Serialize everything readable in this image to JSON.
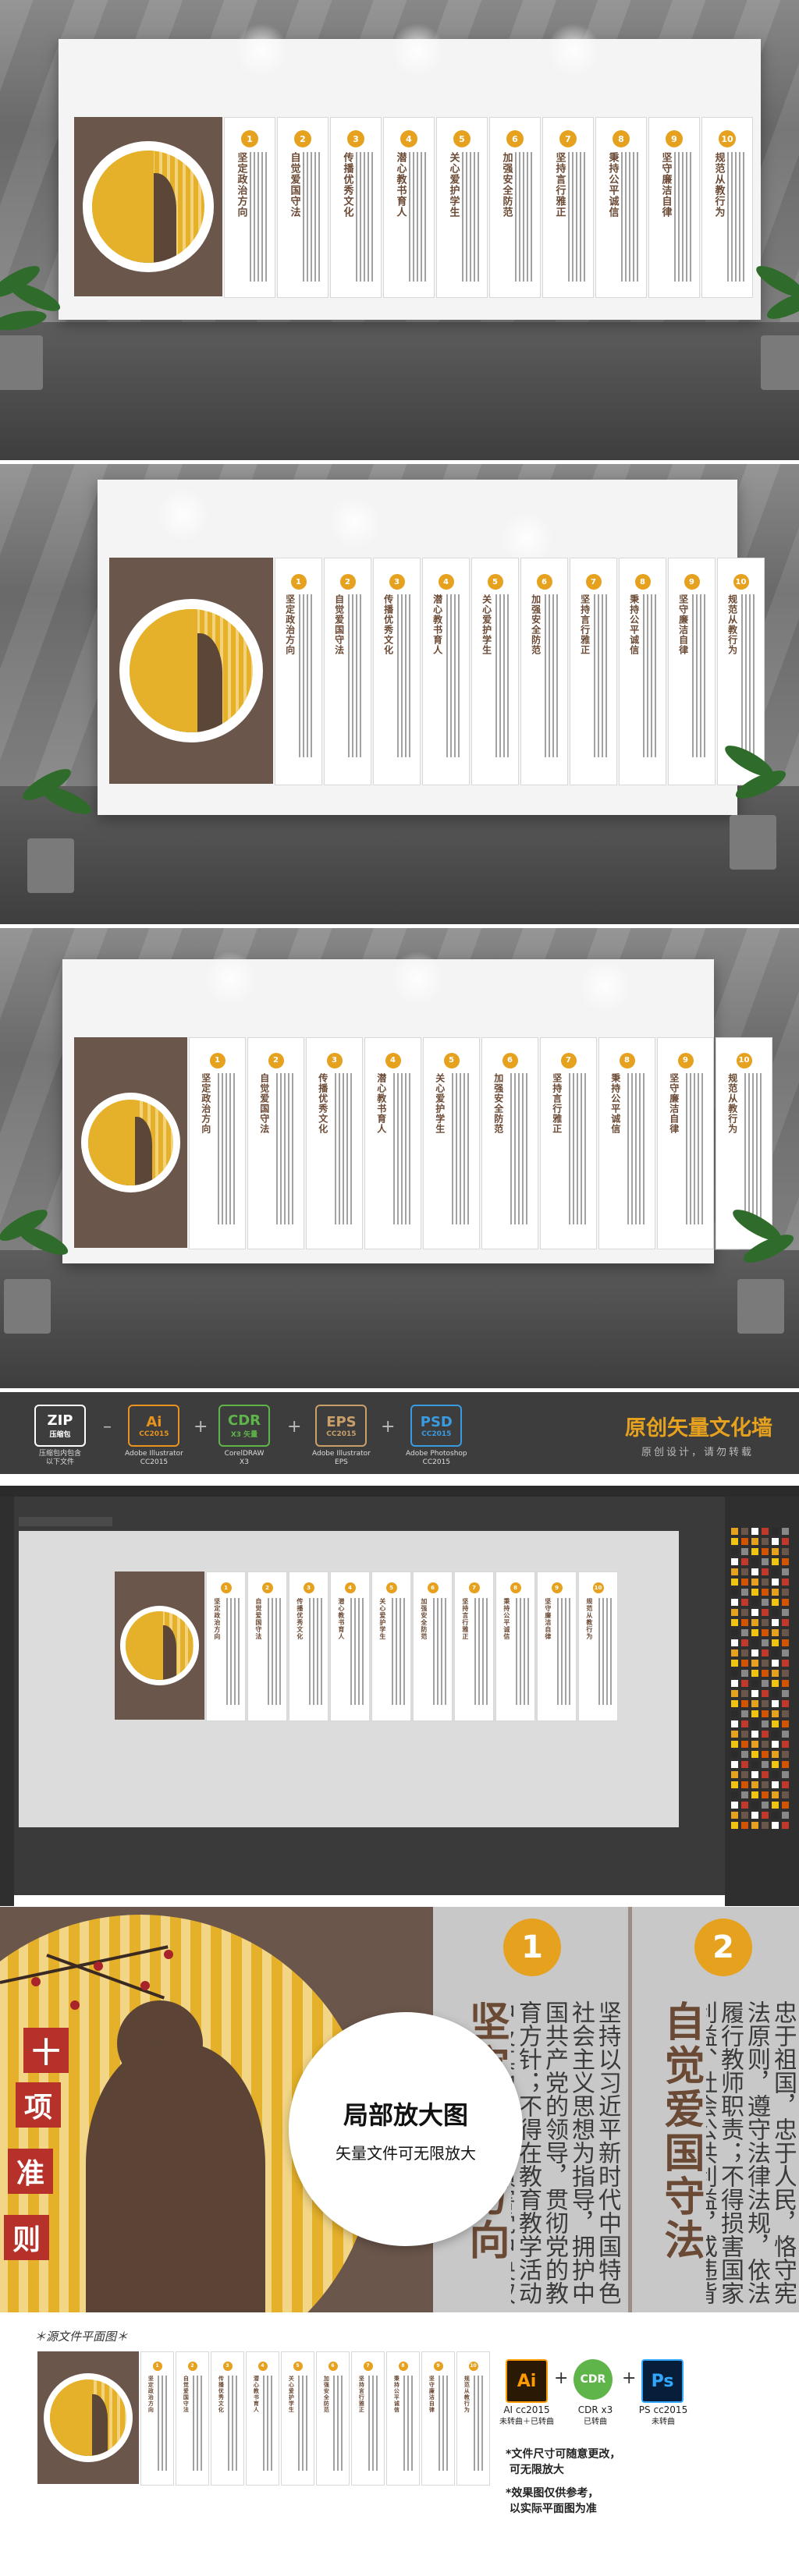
{
  "cards": [
    {
      "n": "1",
      "title": "坚定政治方向"
    },
    {
      "n": "2",
      "title": "自觉爱国守法"
    },
    {
      "n": "3",
      "title": "传播优秀文化"
    },
    {
      "n": "4",
      "title": "潜心教书育人"
    },
    {
      "n": "5",
      "title": "关心爱护学生"
    },
    {
      "n": "6",
      "title": "加强安全防范"
    },
    {
      "n": "7",
      "title": "坚持言行雅正"
    },
    {
      "n": "8",
      "title": "秉持公平诚信"
    },
    {
      "n": "9",
      "title": "坚守廉洁自律"
    },
    {
      "n": "10",
      "title": "规范从教行为"
    }
  ],
  "seal_text": [
    "十",
    "项",
    "准",
    "则"
  ],
  "formats": [
    {
      "key": "zip",
      "badge": "ZIP",
      "badge_sub": "压缩包",
      "caption": "压缩包内包含\n以下文件",
      "color": "#ffffff"
    },
    {
      "key": "ai",
      "badge": "Ai",
      "badge_sub": "CC2015",
      "caption": "Adobe Illustrator\nCC2015",
      "color": "#e8931e"
    },
    {
      "key": "cdr",
      "badge": "CDR",
      "badge_sub": "X3 矢量",
      "caption": "CorelDRAW\nX3",
      "color": "#5fb54a"
    },
    {
      "key": "eps",
      "badge": "EPS",
      "badge_sub": "CC2015",
      "caption": "Adobe Illustrator\nEPS",
      "color": "#c9a06a"
    },
    {
      "key": "psd",
      "badge": "PSD",
      "badge_sub": "CC2015",
      "caption": "Adobe Photoshop\nCC2015",
      "color": "#3a9be0"
    }
  ],
  "format_bar": {
    "title": "原创矢量文化墙",
    "subtitle": "原创设计，请勿转载"
  },
  "zoom": {
    "badge_title": "局部放大图",
    "badge_sub": "矢量文件可无限放大",
    "card1_num": "1",
    "card1_title": "坚定政治方向",
    "card1_body": "坚持以习近平新时代中国特色社会主义思想为指导，拥护中国共产党的领导，贯彻党的教育方针；不得在教育教学活动中及其他场合有损害党中央权威、违背党的路线方针政策的言行。",
    "card2_num": "2",
    "card2_title": "自觉爱国守法",
    "card2_body": "忠于祖国，忠于人民，恪守宪法原则，遵守法律法规，依法履行教师职责；不得损害国家利益、社会公共利益，或违背社会公序良俗。"
  },
  "plan": {
    "title": "＊源文件平面图＊",
    "ai": {
      "badge": "Ai",
      "label": "AI cc2015",
      "sub": "未转曲＋已转曲"
    },
    "cdr": {
      "badge": "CDR",
      "label": "CDR x3",
      "sub": "已转曲"
    },
    "ps": {
      "badge": "Ps",
      "label": "PS cc2015",
      "sub": "未转曲"
    },
    "note1": "*文件尺寸可随意更改，\n 可无限放大",
    "note2": "*效果图仅供参考，\n 以实际平面图为准"
  }
}
